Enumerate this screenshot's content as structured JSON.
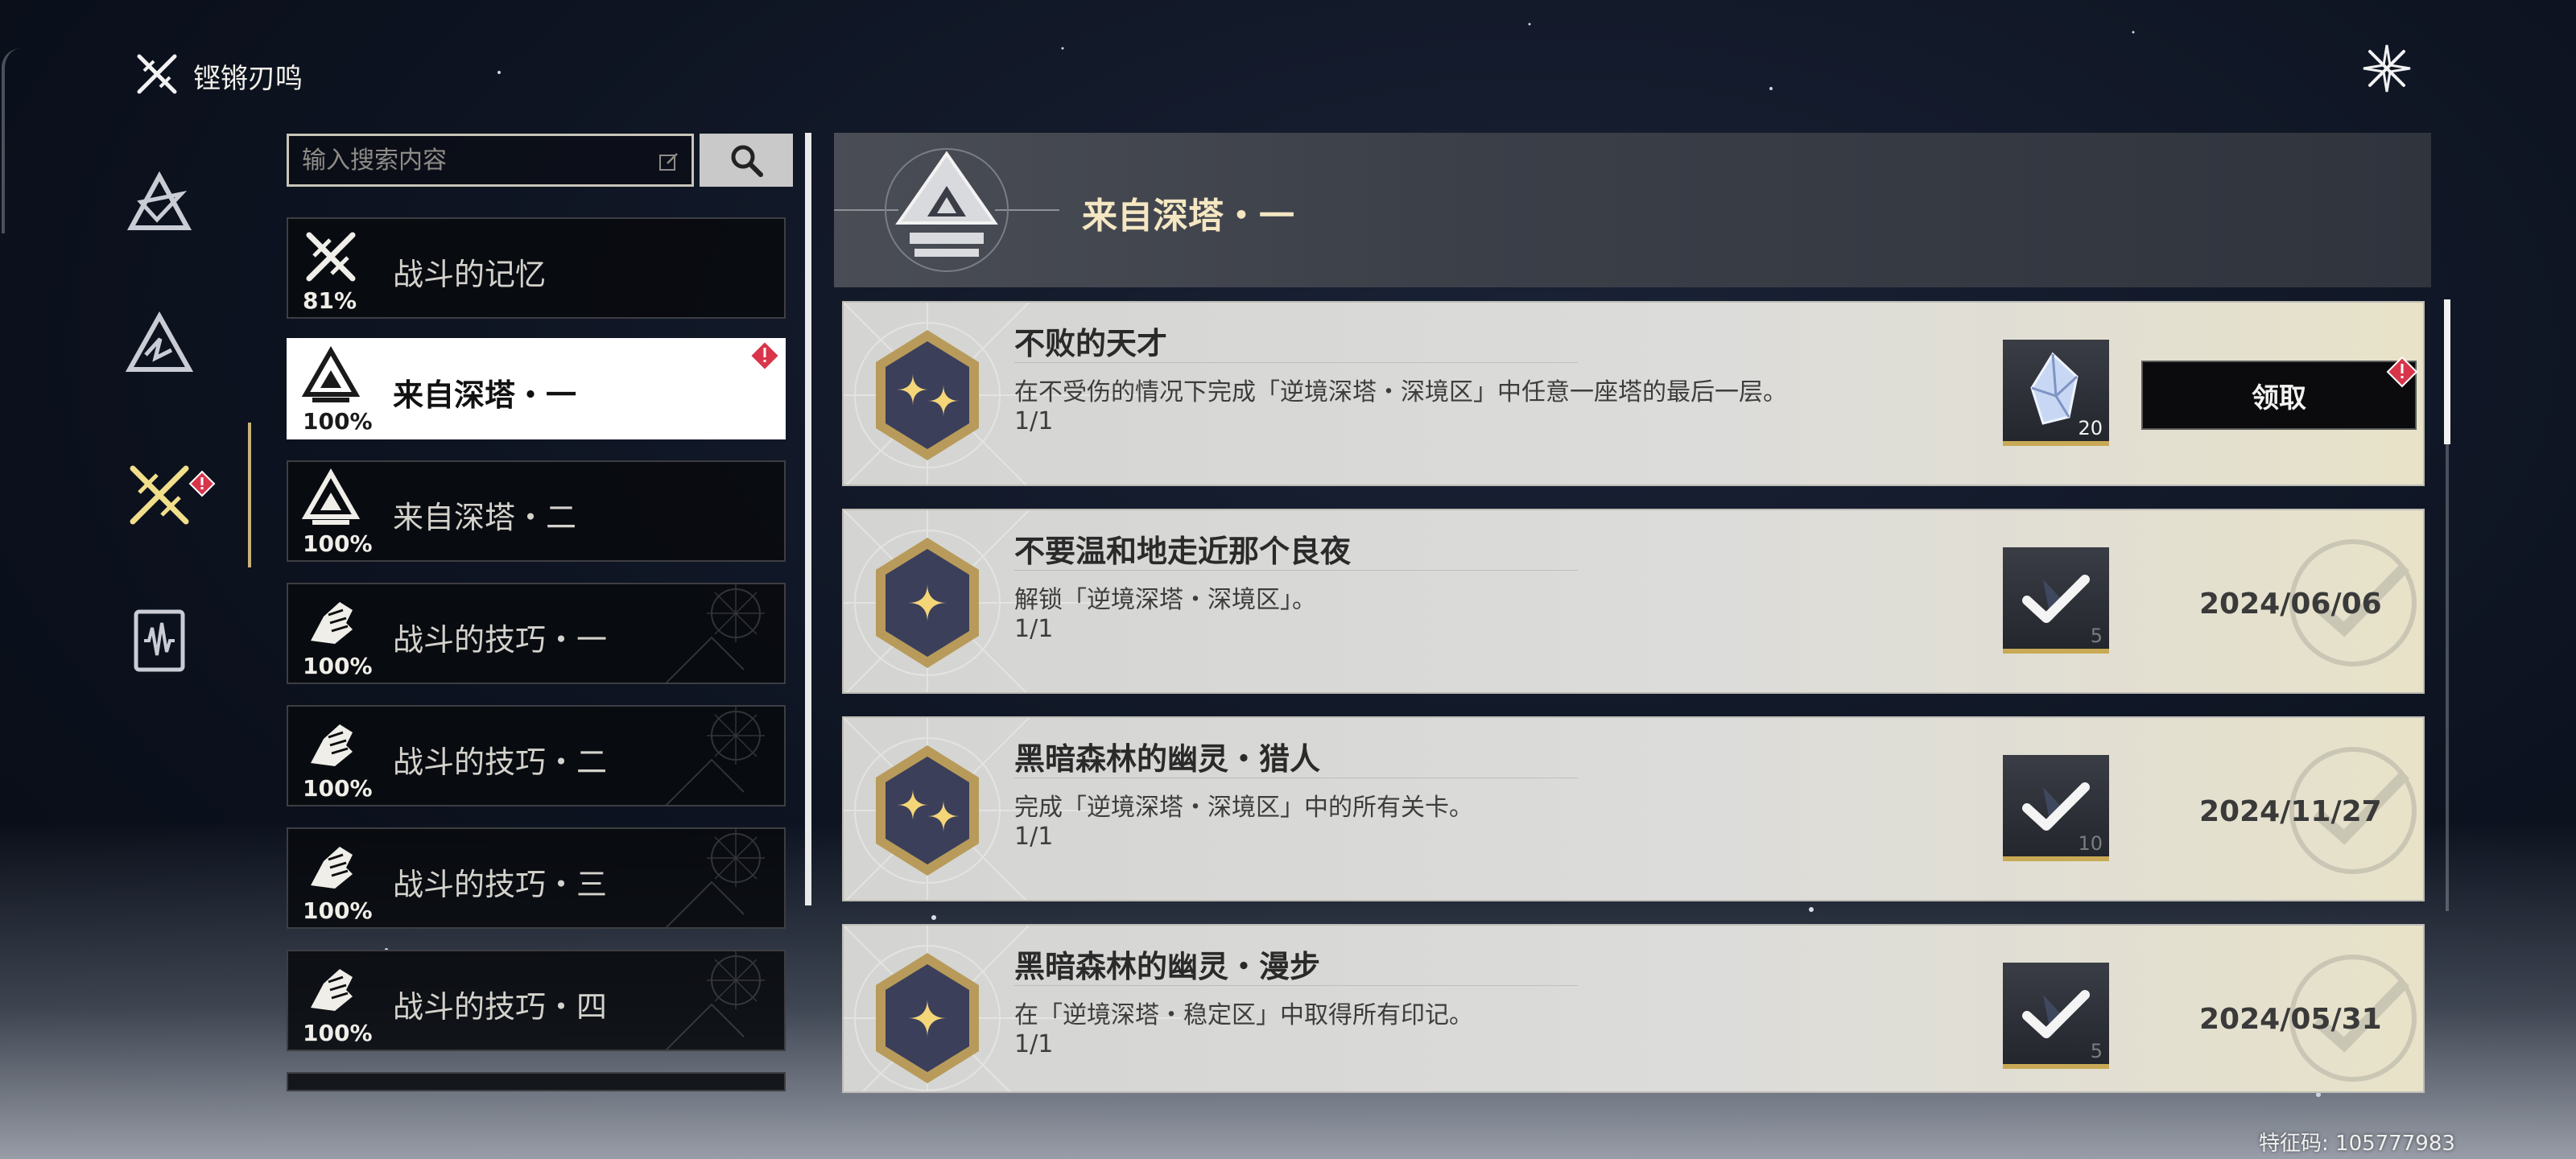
{
  "topbar": {
    "title": "铿锵刃鸣",
    "close_icon": "close-star-icon"
  },
  "nav": {
    "items": [
      {
        "icon": "tower-emblem-icon"
      },
      {
        "icon": "peak-emblem-icon"
      },
      {
        "icon": "crossed-blades-icon",
        "active": true,
        "alert": true
      },
      {
        "icon": "soundwave-card-icon"
      }
    ]
  },
  "search": {
    "placeholder": "输入搜索内容",
    "button_icon": "search-icon"
  },
  "categories": [
    {
      "label": "战斗的记忆",
      "percent": "81%",
      "icon": "crossed-blades-icon"
    },
    {
      "label": "来自深塔・一",
      "percent": "100%",
      "icon": "tower-emblem-icon",
      "active": true,
      "alert": true
    },
    {
      "label": "来自深塔・二",
      "percent": "100%",
      "icon": "tower-emblem-icon"
    },
    {
      "label": "战斗的技巧・一",
      "percent": "100%",
      "icon": "gauntlet-icon"
    },
    {
      "label": "战斗的技巧・二",
      "percent": "100%",
      "icon": "gauntlet-icon"
    },
    {
      "label": "战斗的技巧・三",
      "percent": "100%",
      "icon": "gauntlet-icon"
    },
    {
      "label": "战斗的技巧・四",
      "percent": "100%",
      "icon": "gauntlet-icon"
    }
  ],
  "banner": {
    "title": "来自深塔・一"
  },
  "achievements": [
    {
      "title": "不败的天才",
      "desc": "在不受伤的情况下完成「逆境深塔・深境区」中任意一座塔的最后一层。",
      "progress": "1/1",
      "stars": 2,
      "reward_count": "20",
      "reward_icon": "astrite-crystal-icon",
      "status": "claimable",
      "claim_label": "领取"
    },
    {
      "title": "不要温和地走近那个良夜",
      "desc": "解锁「逆境深塔・深境区」。",
      "progress": "1/1",
      "stars": 1,
      "reward_count": "5",
      "reward_icon": "check-icon",
      "status": "claimed",
      "date": "2024/06/06"
    },
    {
      "title": "黑暗森林的幽灵・猎人",
      "desc": "完成「逆境深塔・深境区」中的所有关卡。",
      "progress": "1/1",
      "stars": 2,
      "reward_count": "10",
      "reward_icon": "check-icon",
      "status": "claimed",
      "date": "2024/11/27"
    },
    {
      "title": "黑暗森林的幽灵・漫步",
      "desc": "在「逆境深塔・稳定区」中取得所有印记。",
      "progress": "1/1",
      "stars": 1,
      "reward_count": "5",
      "reward_icon": "check-icon",
      "status": "claimed",
      "date": "2024/05/31"
    }
  ],
  "footer": {
    "feature_code": "特征码: 105777983"
  },
  "colors": {
    "accent_gold": "#c8b27a",
    "alert_red": "#d8354a",
    "card_bg": "#d8d8d6",
    "banner_title": "#f4e7c2"
  }
}
